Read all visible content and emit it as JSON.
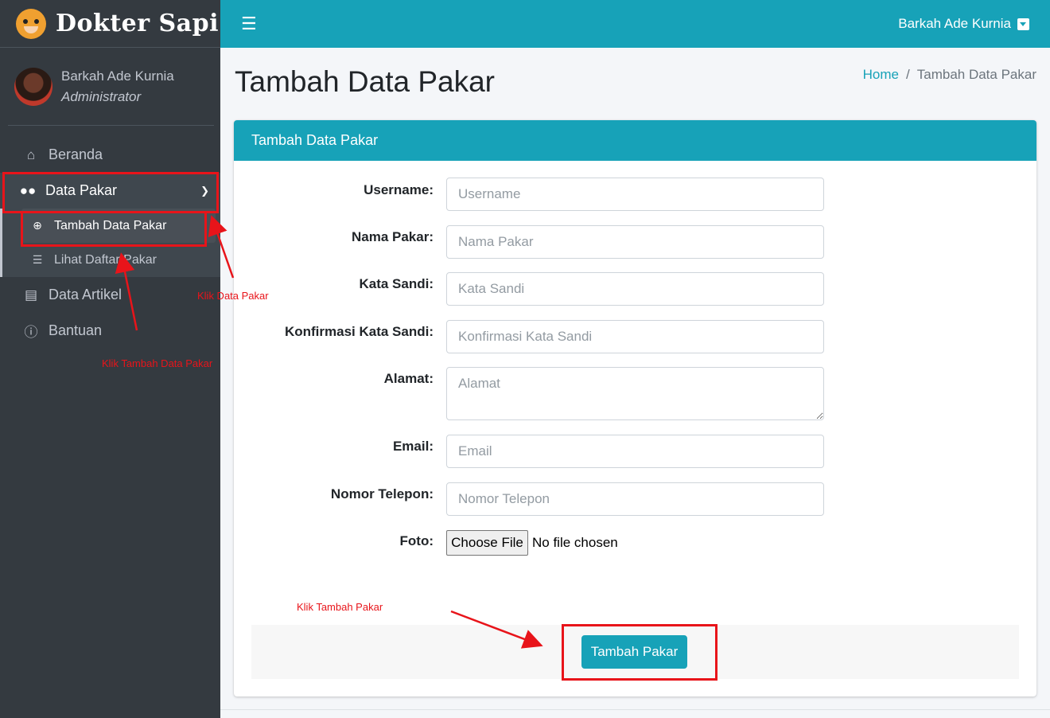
{
  "brand": {
    "name": "Dokter Sapi"
  },
  "user": {
    "name": "Barkah Ade Kurnia",
    "role": "Administrator"
  },
  "sidebar": {
    "items": [
      {
        "label": "Beranda",
        "icon": "home-icon"
      },
      {
        "label": "Data Pakar",
        "icon": "users-icon"
      },
      {
        "label": "Data Artikel",
        "icon": "newspaper-icon"
      },
      {
        "label": "Bantuan",
        "icon": "info-icon"
      }
    ],
    "submenu": [
      {
        "label": "Tambah Data Pakar",
        "icon": "plus-circle-icon"
      },
      {
        "label": "Lihat Daftar Pakar",
        "icon": "list-icon"
      }
    ]
  },
  "topbar": {
    "user_name": "Barkah Ade Kurnia"
  },
  "page": {
    "title": "Tambah Data Pakar"
  },
  "breadcrumb": {
    "home": "Home",
    "separator": "/",
    "current": "Tambah Data Pakar"
  },
  "form": {
    "header": "Tambah Data Pakar",
    "fields": [
      {
        "label": "Username:",
        "placeholder": "Username"
      },
      {
        "label": "Nama Pakar:",
        "placeholder": "Nama Pakar"
      },
      {
        "label": "Kata Sandi:",
        "placeholder": "Kata Sandi"
      },
      {
        "label": "Konfirmasi Kata Sandi:",
        "placeholder": "Konfirmasi Kata Sandi"
      },
      {
        "label": "Alamat:",
        "placeholder": "Alamat"
      },
      {
        "label": "Email:",
        "placeholder": "Email"
      },
      {
        "label": "Nomor Telepon:",
        "placeholder": "Nomor Telepon"
      }
    ],
    "photo": {
      "label": "Foto:",
      "button": "Choose File",
      "status": "No file chosen"
    },
    "submit": "Tambah Pakar"
  },
  "annotations": {
    "data_pakar": "Klik Data Pakar",
    "tambah_data_pakar": "Klik Tambah Data Pakar",
    "tambah_pakar": "Klik Tambah Pakar"
  },
  "colors": {
    "accent": "#17a2b8",
    "sidebar": "#343a40",
    "annotation": "#e8141a"
  }
}
